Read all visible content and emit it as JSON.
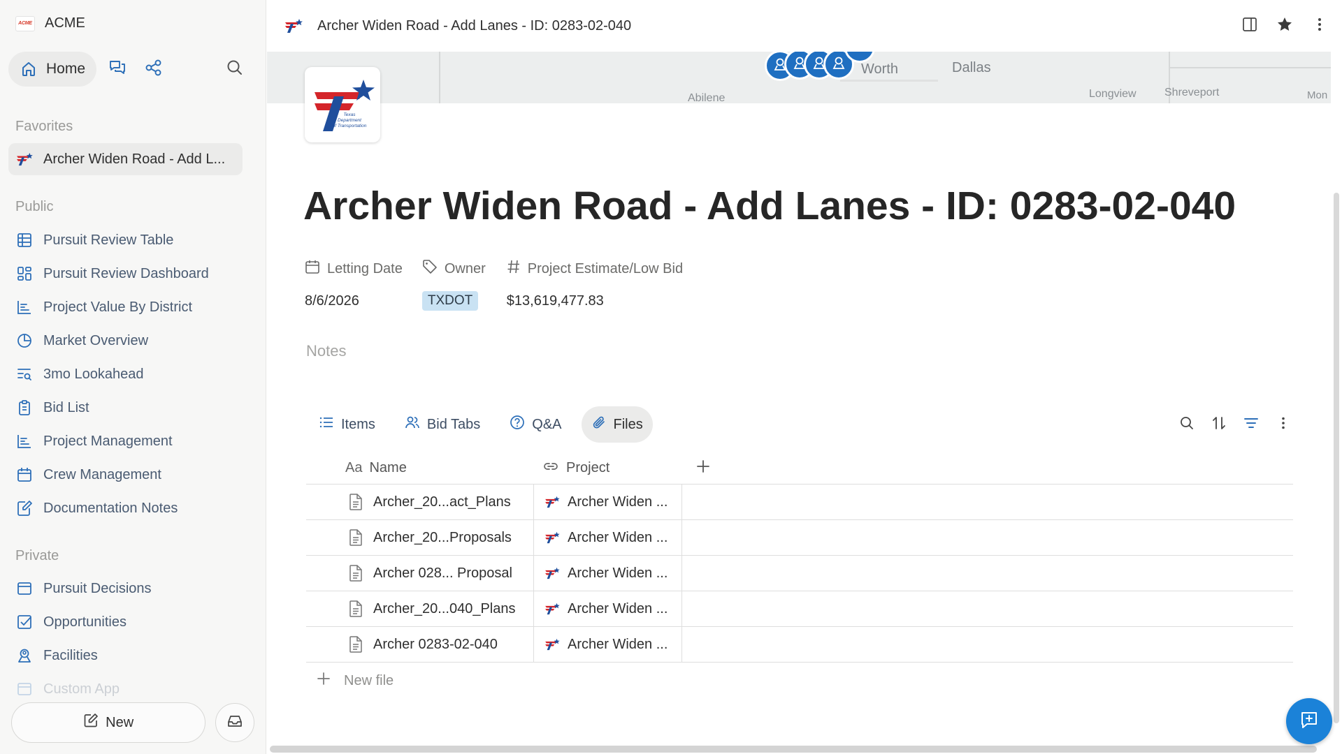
{
  "workspace": {
    "logo_text": "ACME",
    "name": "ACME"
  },
  "sidebar": {
    "home_label": "Home",
    "favorites_title": "Favorites",
    "favorites": [
      {
        "label": "Archer Widen Road - Add L...",
        "icon": "txdot-logo-icon"
      }
    ],
    "public_title": "Public",
    "public_items": [
      {
        "label": "Pursuit Review Table",
        "icon": "table-icon"
      },
      {
        "label": "Pursuit Review Dashboard",
        "icon": "dashboard-icon"
      },
      {
        "label": "Project Value By District",
        "icon": "bar-chart-icon"
      },
      {
        "label": "Market Overview",
        "icon": "pie-chart-icon"
      },
      {
        "label": "3mo Lookahead",
        "icon": "list-search-icon"
      },
      {
        "label": "Bid List",
        "icon": "clipboard-icon"
      },
      {
        "label": "Project Management",
        "icon": "bar-chart-icon"
      },
      {
        "label": "Crew Management",
        "icon": "calendar-icon"
      },
      {
        "label": "Documentation Notes",
        "icon": "edit-note-icon"
      }
    ],
    "private_title": "Private",
    "private_items": [
      {
        "label": "Pursuit Decisions",
        "icon": "window-icon"
      },
      {
        "label": "Opportunities",
        "icon": "checkbox-icon"
      },
      {
        "label": "Facilities",
        "icon": "person-pin-icon"
      },
      {
        "label": "Custom App",
        "icon": "window-icon"
      }
    ],
    "new_label": "New"
  },
  "page": {
    "title": "Archer Widen Road - Add Lanes - ID: 0283-02-040",
    "icon_caption": "Texas Department of Transportation",
    "map_labels": [
      "Worth",
      "Dallas",
      "Abilene",
      "Longview",
      "Shreveport",
      "Mon"
    ],
    "properties": [
      {
        "name": "Letting Date",
        "icon": "calendar-icon",
        "value": "8/6/2026"
      },
      {
        "name": "Owner",
        "icon": "tag-icon",
        "value": "TXDOT"
      },
      {
        "name": "Project Estimate/Low Bid",
        "icon": "hash-icon",
        "value": "$13,619,477.83"
      }
    ],
    "notes_placeholder": "Notes"
  },
  "tabs": [
    {
      "label": "Items",
      "icon": "list-icon"
    },
    {
      "label": "Bid Tabs",
      "icon": "people-icon"
    },
    {
      "label": "Q&A",
      "icon": "question-icon"
    },
    {
      "label": "Files",
      "icon": "paperclip-icon",
      "active": true
    }
  ],
  "table": {
    "columns": [
      {
        "prefix": "Aa",
        "label": "Name"
      },
      {
        "label": "Project",
        "icon": "link-icon"
      }
    ],
    "rows": [
      {
        "name": "Archer_20...act_Plans",
        "project": "Archer Widen ..."
      },
      {
        "name": "Archer_20...Proposals",
        "project": "Archer Widen ..."
      },
      {
        "name": "Archer 028... Proposal",
        "project": "Archer Widen ..."
      },
      {
        "name": "Archer_20...040_Plans",
        "project": "Archer Widen ..."
      },
      {
        "name": "Archer 0283-02-040",
        "project": "Archer Widen ..."
      }
    ],
    "new_row_label": "New file"
  },
  "colors": {
    "accent": "#1b82d8",
    "tag_bg": "#c9e2f3",
    "txdot_blue": "#1f4e9c",
    "txdot_red": "#d4252a"
  }
}
